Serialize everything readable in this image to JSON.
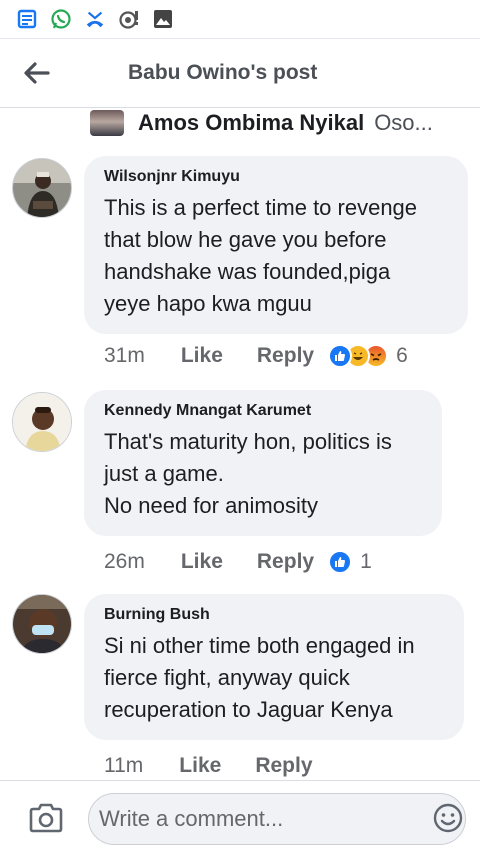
{
  "status_bar": {
    "icons": [
      "news-icon",
      "whatsapp-icon",
      "missed-call-icon",
      "hotspot-icon",
      "gallery-icon"
    ]
  },
  "header": {
    "title": "Babu Owino's post"
  },
  "reply_preview": {
    "name": "Amos Ombima Nyikal",
    "text": "Oso..."
  },
  "comments": [
    {
      "author": "Wilsonjnr Kimuyu",
      "text": "This is a perfect time to revenge\nthat blow he gave you before\nhandshake was founded,piga\nyeye hapo kwa mguu",
      "time": "31m",
      "like_label": "Like",
      "reply_label": "Reply",
      "reactions": [
        "like",
        "haha",
        "angry"
      ],
      "reaction_count": "6"
    },
    {
      "author": "Kennedy Mnangat Karumet",
      "text": "That's maturity hon, politics is\njust a game.\nNo need for animosity",
      "time": "26m",
      "like_label": "Like",
      "reply_label": "Reply",
      "reactions": [
        "like"
      ],
      "reaction_count": "1"
    },
    {
      "author": "Burning Bush",
      "text": "Si ni other time both engaged in\nfierce fight, anyway quick\nrecuperation to Jaguar Kenya",
      "time": "11m",
      "like_label": "Like",
      "reply_label": "Reply",
      "reactions": [],
      "reaction_count": ""
    }
  ],
  "composer": {
    "placeholder": "Write a comment..."
  },
  "colors": {
    "facebook_blue": "#1877f2",
    "whatsapp_green": "#25d366",
    "bubble_gray": "#f0f2f5",
    "meta_gray": "#65676b"
  }
}
